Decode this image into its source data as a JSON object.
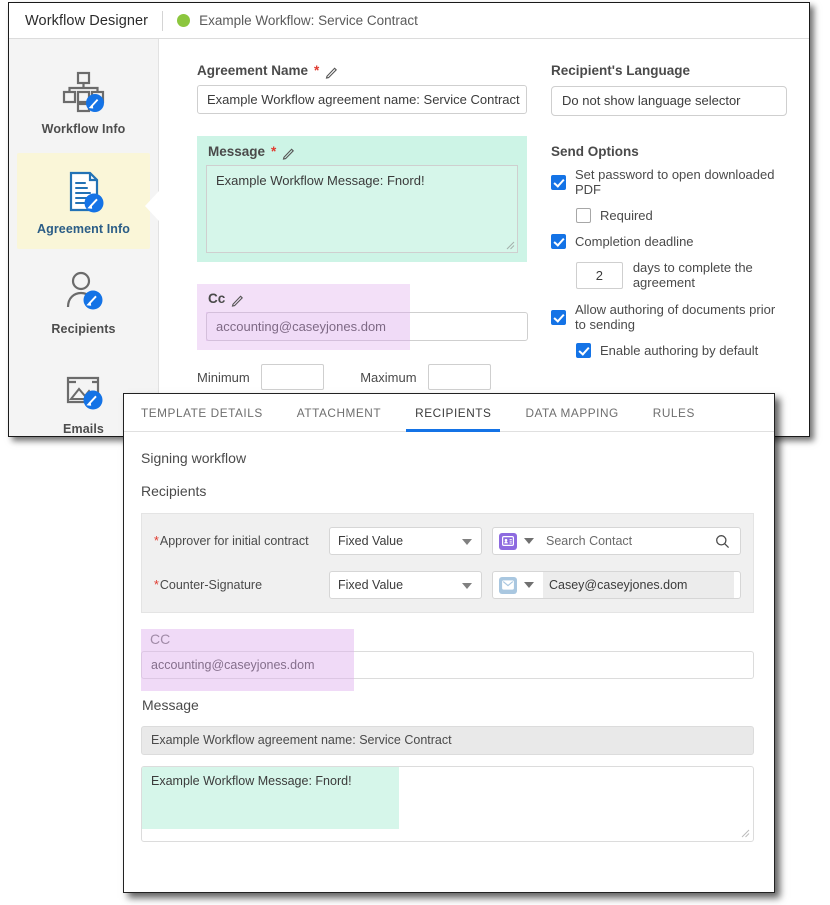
{
  "window": {
    "app_title": "Workflow Designer",
    "workflow_name": "Example Workflow: Service Contract",
    "status_dot_color": "#8cc63e"
  },
  "rail": {
    "items": [
      {
        "label": "Workflow Info",
        "icon": "workflow-tree-edit-icon",
        "active": false
      },
      {
        "label": "Agreement Info",
        "icon": "document-edit-icon",
        "active": true
      },
      {
        "label": "Recipients",
        "icon": "person-edit-icon",
        "active": false
      },
      {
        "label": "Emails",
        "icon": "email-image-edit-icon",
        "active": false
      }
    ]
  },
  "form": {
    "agreement_name": {
      "label": "Agreement Name",
      "required_mark": "*",
      "value": "Example Workflow agreement name: Service Contract"
    },
    "message": {
      "label": "Message",
      "required_mark": "*",
      "value": "Example Workflow Message: Fnord!"
    },
    "cc": {
      "label": "Cc",
      "value": "accounting@caseyjones.dom",
      "minimum_label": "Minimum",
      "minimum_value": "",
      "maximum_label": "Maximum",
      "maximum_value": ""
    },
    "recipients_language": {
      "label": "Recipient's Language",
      "value": "Do not show language selector"
    },
    "send_options": {
      "title": "Send Options",
      "options": [
        {
          "label": "Set password to open downloaded PDF",
          "checked": true,
          "indent": false
        },
        {
          "label": "Required",
          "checked": false,
          "indent": true
        },
        {
          "label": "Completion deadline",
          "checked": true,
          "indent": false
        },
        {
          "label": "Allow authoring of documents prior to sending",
          "checked": true,
          "indent": false
        },
        {
          "label": "Enable authoring by default",
          "checked": true,
          "indent": true
        }
      ],
      "deadline_days": "2",
      "deadline_suffix": "days to complete the agreement"
    }
  },
  "overlay": {
    "tabs": [
      {
        "label": "TEMPLATE DETAILS",
        "active": false
      },
      {
        "label": "ATTACHMENT",
        "active": false
      },
      {
        "label": "RECIPIENTS",
        "active": true
      },
      {
        "label": "DATA MAPPING",
        "active": false
      },
      {
        "label": "RULES",
        "active": false
      }
    ],
    "signing_workflow_title": "Signing workflow",
    "recipients_title": "Recipients",
    "recipient_rows": [
      {
        "required_mark": "*",
        "label": "Approver for initial contract",
        "mode": "Fixed Value",
        "role_icon": "contact-card-icon",
        "role_icon_color": "#8d6ae0",
        "contact_placeholder": "Search Contact",
        "contact_value": "",
        "has_search_icon": true
      },
      {
        "required_mark": "*",
        "label": "Counter-Signature",
        "mode": "Fixed Value",
        "role_icon": "envelope-icon",
        "role_icon_color": "#a9c7e0",
        "contact_placeholder": "",
        "contact_value": "Casey@caseyjones.dom",
        "has_search_icon": false
      }
    ],
    "cc": {
      "label": "CC",
      "value": "accounting@caseyjones.dom"
    },
    "message": {
      "title": "Message",
      "subject": "Example Workflow agreement name: Service Contract",
      "body": "Example Workflow Message: Fnord!"
    }
  },
  "colors": {
    "accent_blue": "#1473e6",
    "highlight_green": "#cdf4e6",
    "highlight_purple": "#f3e0f8",
    "active_rail": "#faf6d8",
    "required_red": "#e03a2f"
  }
}
